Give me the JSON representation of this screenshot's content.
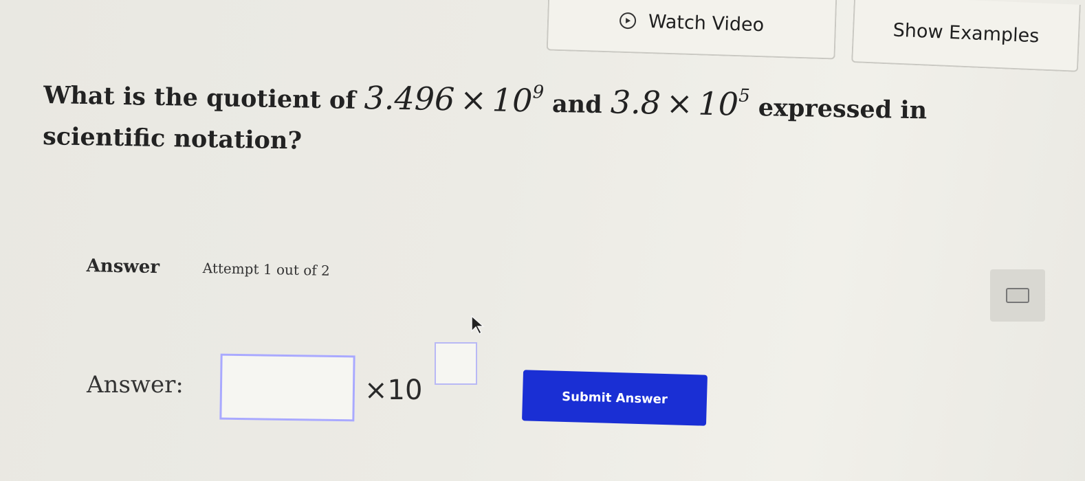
{
  "top_buttons": {
    "watch_video": "Watch Video",
    "show_examples": "Show Examples"
  },
  "question": {
    "text_before": "What is the quotient of",
    "first_number": {
      "coefficient": "3.496",
      "times": "×",
      "base": "10",
      "exponent": "9"
    },
    "text_and": "and",
    "second_number": {
      "coefficient": "3.8",
      "times": "×",
      "base": "10",
      "exponent": "5"
    },
    "text_after": "expressed in scientific notation?"
  },
  "answer_section": {
    "heading": "Answer",
    "attempt": "Attempt 1 out of 2"
  },
  "answer_row": {
    "label": "Answer:",
    "mantissa_value": "",
    "times_ten": "×10",
    "exponent_value": ""
  },
  "submit": {
    "label": "Submit Answer"
  },
  "colors": {
    "submit_background": "#1a2fd4",
    "input_border": "#a9a9ff",
    "page_background": "#ecebe5"
  },
  "icons": {
    "watch_video": "play-circle-icon",
    "calculator": "calculator-icon",
    "pointer": "mouse-cursor-icon"
  }
}
